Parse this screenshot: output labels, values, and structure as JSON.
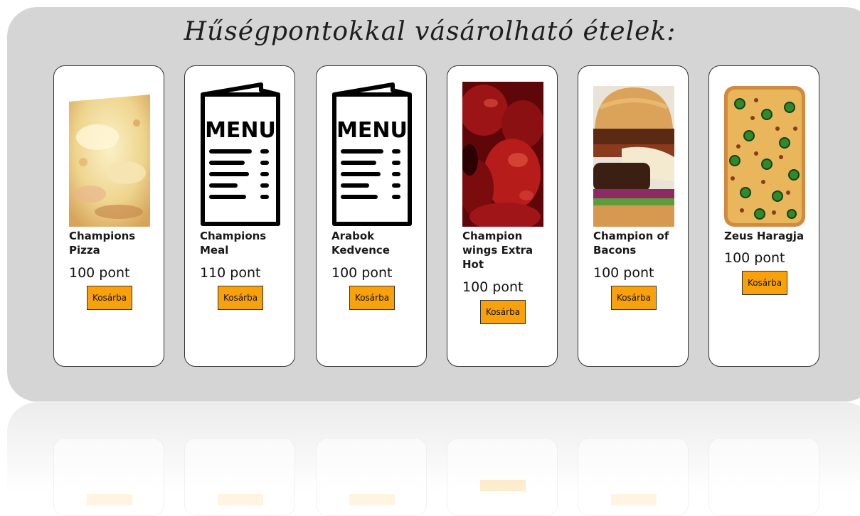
{
  "page": {
    "title": "Hűségpontokkal vásárolható ételek:"
  },
  "colors": {
    "panel": "#d6d5d5",
    "button": "#f9a10b",
    "card_border": "#333333"
  },
  "items": [
    {
      "name": "Champions Pizza",
      "points": "100 pont",
      "button": "Kosárba",
      "image": "pizza-image"
    },
    {
      "name": "Champions Meal",
      "points": "110 pont",
      "button": "Kosárba",
      "image": "menu-icon"
    },
    {
      "name": "Arabok Kedvence",
      "points": "100 pont",
      "button": "Kosárba",
      "image": "menu-icon"
    },
    {
      "name": "Champion wings Extra Hot",
      "points": "100 pont",
      "button": "Kosárba",
      "image": "chicken-wings-image"
    },
    {
      "name": "Champion of Bacons",
      "points": "100 pont",
      "button": "Kosárba",
      "image": "burger-image"
    },
    {
      "name": "Zeus Haragja",
      "points": "100 pont",
      "button": "Kosárba",
      "image": "jalapeno-pizza-image"
    }
  ]
}
